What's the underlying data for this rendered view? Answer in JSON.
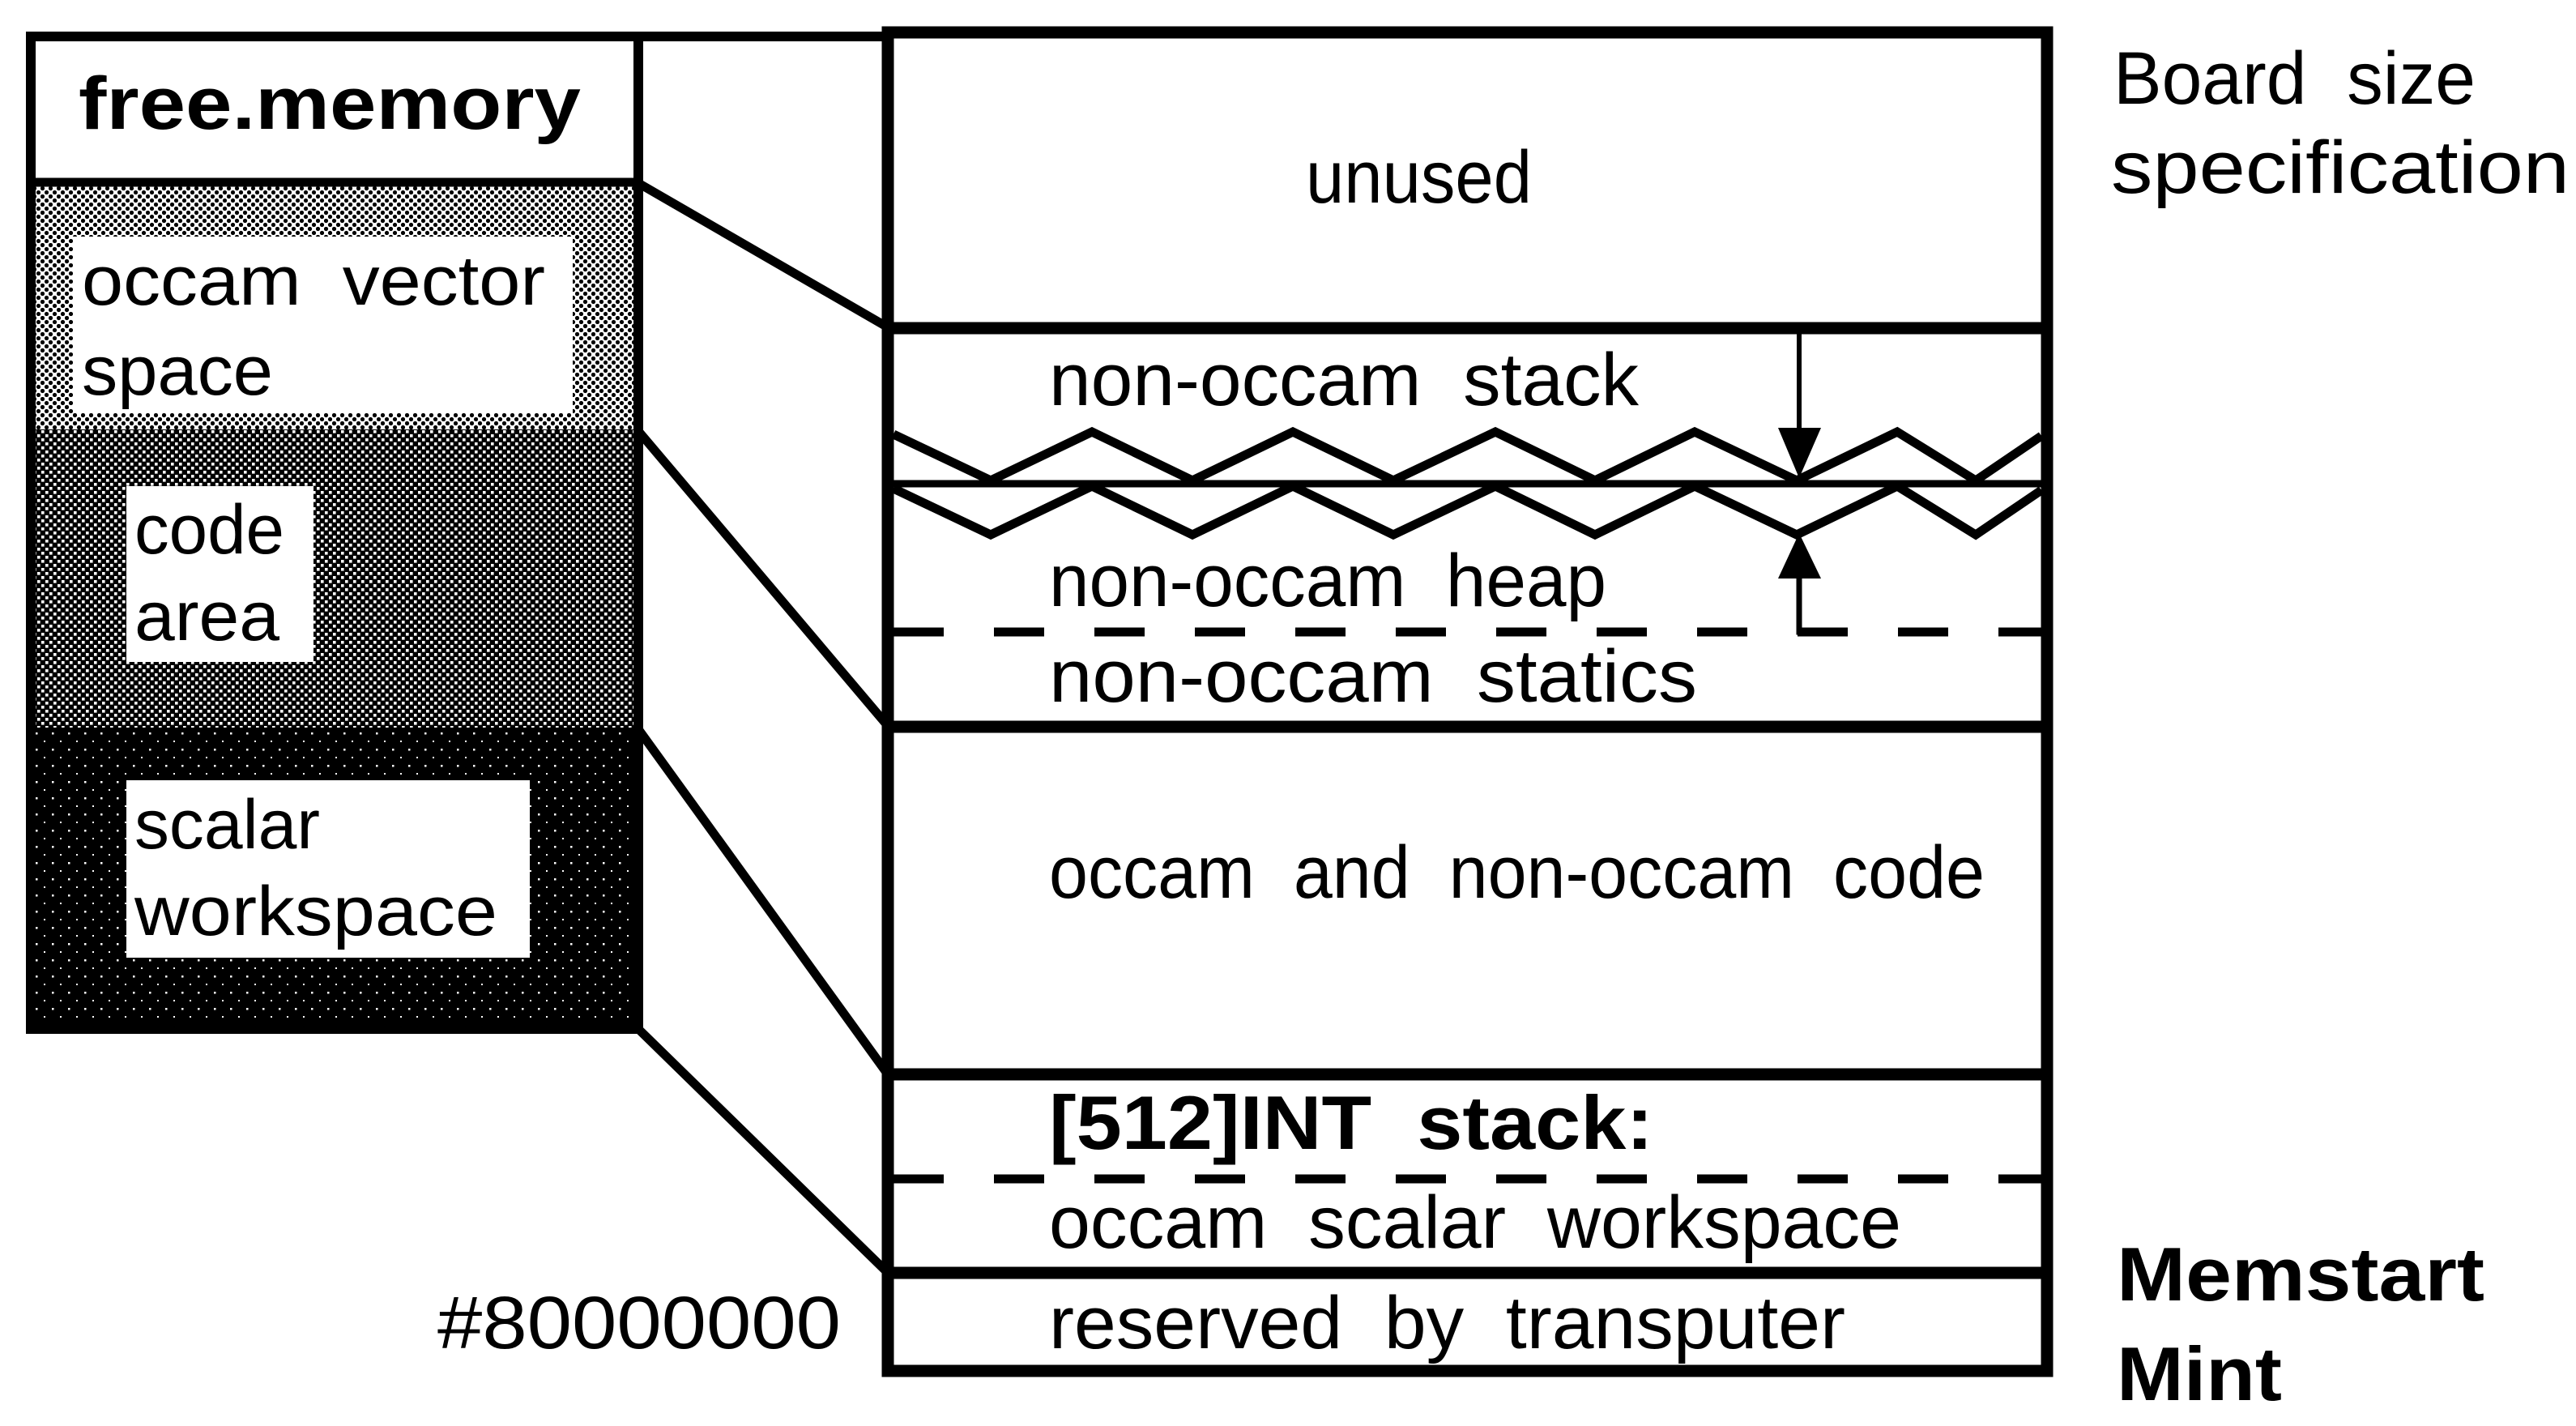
{
  "figure": {
    "left_block": {
      "title": "free.memory",
      "sections": [
        {
          "id": "occam-vector-space",
          "lines": [
            "occam  vector",
            "space"
          ],
          "shading": "light-dots"
        },
        {
          "id": "code-area",
          "lines": [
            "code",
            "area"
          ],
          "shading": "medium-dots"
        },
        {
          "id": "scalar-workspace",
          "lines": [
            "scalar",
            "workspace"
          ],
          "shading": "dark"
        }
      ]
    },
    "memory_map": {
      "regions": [
        {
          "id": "unused",
          "label": "unused"
        },
        {
          "id": "non-occam-stack",
          "label": "non-occam  stack"
        },
        {
          "id": "non-occam-heap",
          "label": "non-occam  heap"
        },
        {
          "id": "non-occam-statics",
          "label": "non-occam  statics"
        },
        {
          "id": "code",
          "label": "occam  and  non-occam  code"
        },
        {
          "id": "int-stack",
          "label": "[512]INT  stack:"
        },
        {
          "id": "occam-scalar-workspace",
          "label": "occam  scalar  workspace"
        },
        {
          "id": "reserved",
          "label": "reserved  by  transputer"
        }
      ],
      "address_label": "#80000000"
    },
    "annotations": {
      "board_size": [
        "Board  size",
        "specification"
      ],
      "memstart": "Memstart",
      "mint": "Mint"
    },
    "colors": {
      "ink": "#000000",
      "paper": "#ffffff"
    }
  }
}
